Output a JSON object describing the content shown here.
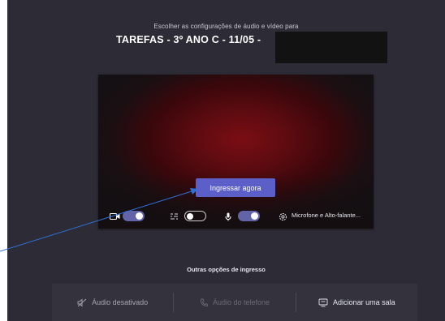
{
  "prejoin": {
    "subtitle": "Escolher as configurações de áudio e vídeo para",
    "meeting_title": "TAREFAS - 3º ANO C - 11/05 -",
    "join_button": "Ingressar agora",
    "camera": {
      "icon": "camera-icon",
      "enabled": true
    },
    "background_effects": {
      "icon": "background-blur-icon",
      "enabled": false
    },
    "microphone": {
      "icon": "microphone-icon",
      "enabled": true
    },
    "device_settings": {
      "icon": "gear-icon",
      "label": "Microfone e Alto-falante..."
    }
  },
  "other_options": {
    "heading": "Outras opções de ingresso",
    "items": [
      {
        "icon": "speaker-muted-icon",
        "label": "Áudio desativado"
      },
      {
        "icon": "phone-icon",
        "label": "Áudio do telefone"
      },
      {
        "icon": "room-icon",
        "label": "Adicionar uma sala"
      }
    ]
  },
  "colors": {
    "background": "#2d2c36",
    "accent": "#5b5fc7",
    "toggle_on": "#6264a7",
    "annotation_arrow": "#2f6fd6"
  }
}
